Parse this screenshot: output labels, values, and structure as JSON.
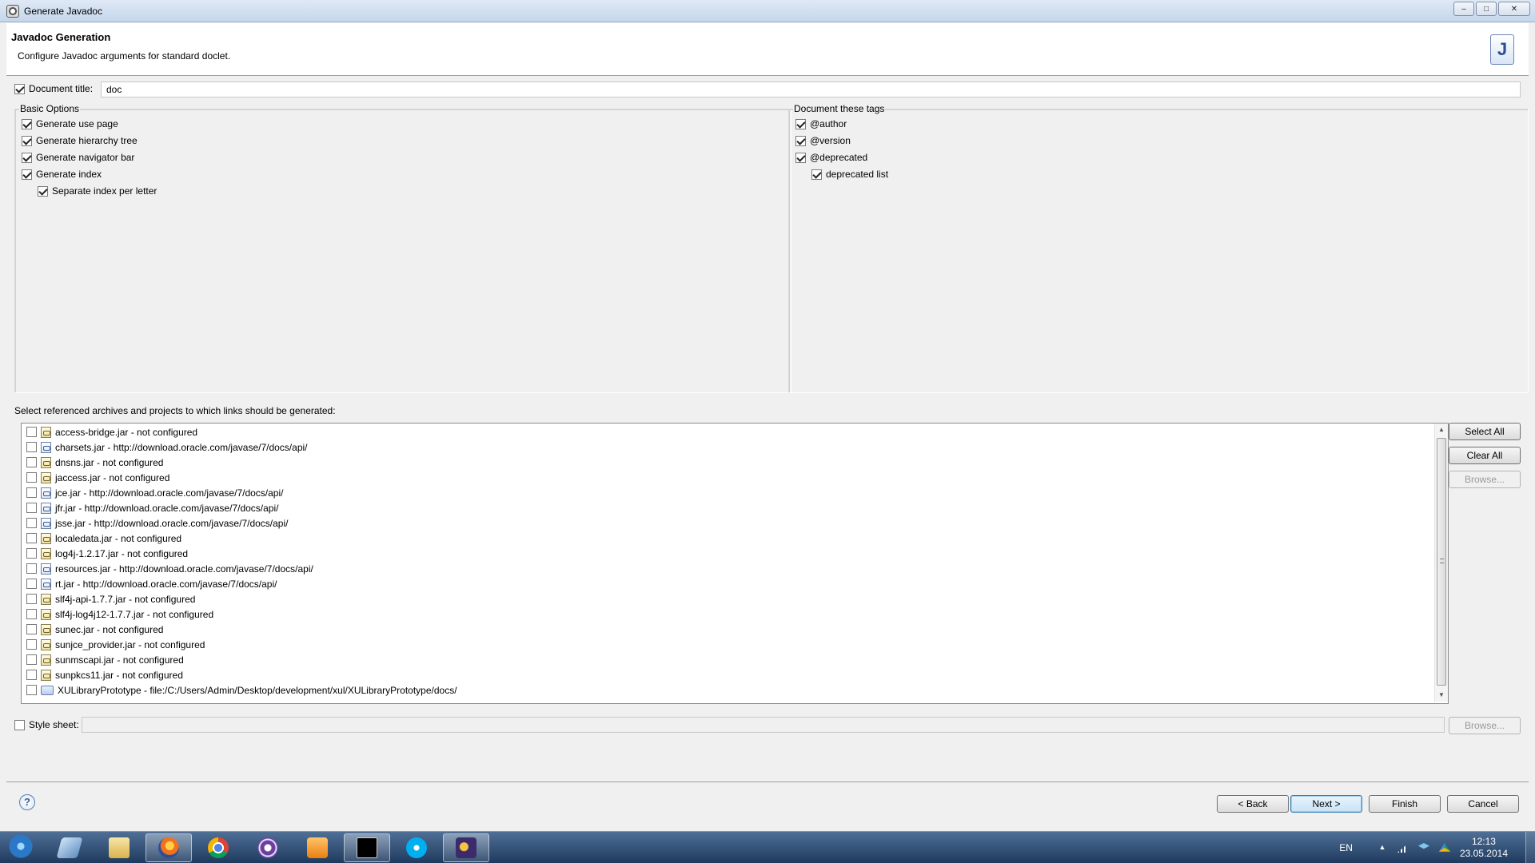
{
  "window": {
    "title": "Generate Javadoc",
    "controls": {
      "minimize": "‒",
      "maximize": "□",
      "close": "✕"
    }
  },
  "banner": {
    "title": "Javadoc Generation",
    "description": "Configure Javadoc arguments for standard doclet.",
    "icon_glyph": "J"
  },
  "document_title": {
    "label": "Document title:",
    "checked": true,
    "value": "doc"
  },
  "basic_options": {
    "label": "Basic Options",
    "items": [
      {
        "label": "Generate use page",
        "checked": true
      },
      {
        "label": "Generate hierarchy tree",
        "checked": true
      },
      {
        "label": "Generate navigator bar",
        "checked": true
      },
      {
        "label": "Generate index",
        "checked": true
      },
      {
        "label": "Separate index per letter",
        "checked": true
      }
    ]
  },
  "tags": {
    "label": "Document these tags",
    "items": [
      {
        "label": "@author",
        "checked": true
      },
      {
        "label": "@version",
        "checked": true
      },
      {
        "label": "@deprecated",
        "checked": true
      },
      {
        "label": "deprecated list",
        "checked": true
      }
    ]
  },
  "links": {
    "label": "Select referenced archives and projects to which links should be generated:",
    "items": [
      {
        "label": "access-bridge.jar - not configured",
        "icon": "jar"
      },
      {
        "label": "charsets.jar - http://download.oracle.com/javase/7/docs/api/",
        "icon": "web"
      },
      {
        "label": "dnsns.jar - not configured",
        "icon": "jar"
      },
      {
        "label": "jaccess.jar - not configured",
        "icon": "jar"
      },
      {
        "label": "jce.jar - http://download.oracle.com/javase/7/docs/api/",
        "icon": "web"
      },
      {
        "label": "jfr.jar - http://download.oracle.com/javase/7/docs/api/",
        "icon": "web"
      },
      {
        "label": "jsse.jar - http://download.oracle.com/javase/7/docs/api/",
        "icon": "web"
      },
      {
        "label": "localedata.jar - not configured",
        "icon": "jar"
      },
      {
        "label": "log4j-1.2.17.jar - not configured",
        "icon": "jar"
      },
      {
        "label": "resources.jar - http://download.oracle.com/javase/7/docs/api/",
        "icon": "web"
      },
      {
        "label": "rt.jar - http://download.oracle.com/javase/7/docs/api/",
        "icon": "web"
      },
      {
        "label": "slf4j-api-1.7.7.jar - not configured",
        "icon": "jar"
      },
      {
        "label": "slf4j-log4j12-1.7.7.jar - not configured",
        "icon": "jar"
      },
      {
        "label": "sunec.jar - not configured",
        "icon": "jar"
      },
      {
        "label": "sunjce_provider.jar - not configured",
        "icon": "jar"
      },
      {
        "label": "sunmscapi.jar - not configured",
        "icon": "jar"
      },
      {
        "label": "sunpkcs11.jar - not configured",
        "icon": "jar"
      },
      {
        "label": "XULibraryPrototype - file:/C:/Users/Admin/Desktop/development/xul/XULibraryPrototype/docs/",
        "icon": "project"
      }
    ],
    "buttons": {
      "select_all": "Select All",
      "clear_all": "Clear All",
      "browse": "Browse..."
    }
  },
  "style_sheet": {
    "label": "Style sheet:",
    "checked": false,
    "value": "",
    "browse": "Browse..."
  },
  "footer": {
    "help": "?",
    "back": "< Back",
    "next": "Next >",
    "finish": "Finish",
    "cancel": "Cancel"
  },
  "taskbar": {
    "apps": [
      "windows-explorer",
      "file-manager",
      "firefox",
      "chrome",
      "torrent-client",
      "media-player",
      "command-prompt",
      "skype",
      "eclipse"
    ],
    "language": "EN",
    "time": "12:13",
    "date": "23.05.2014"
  }
}
